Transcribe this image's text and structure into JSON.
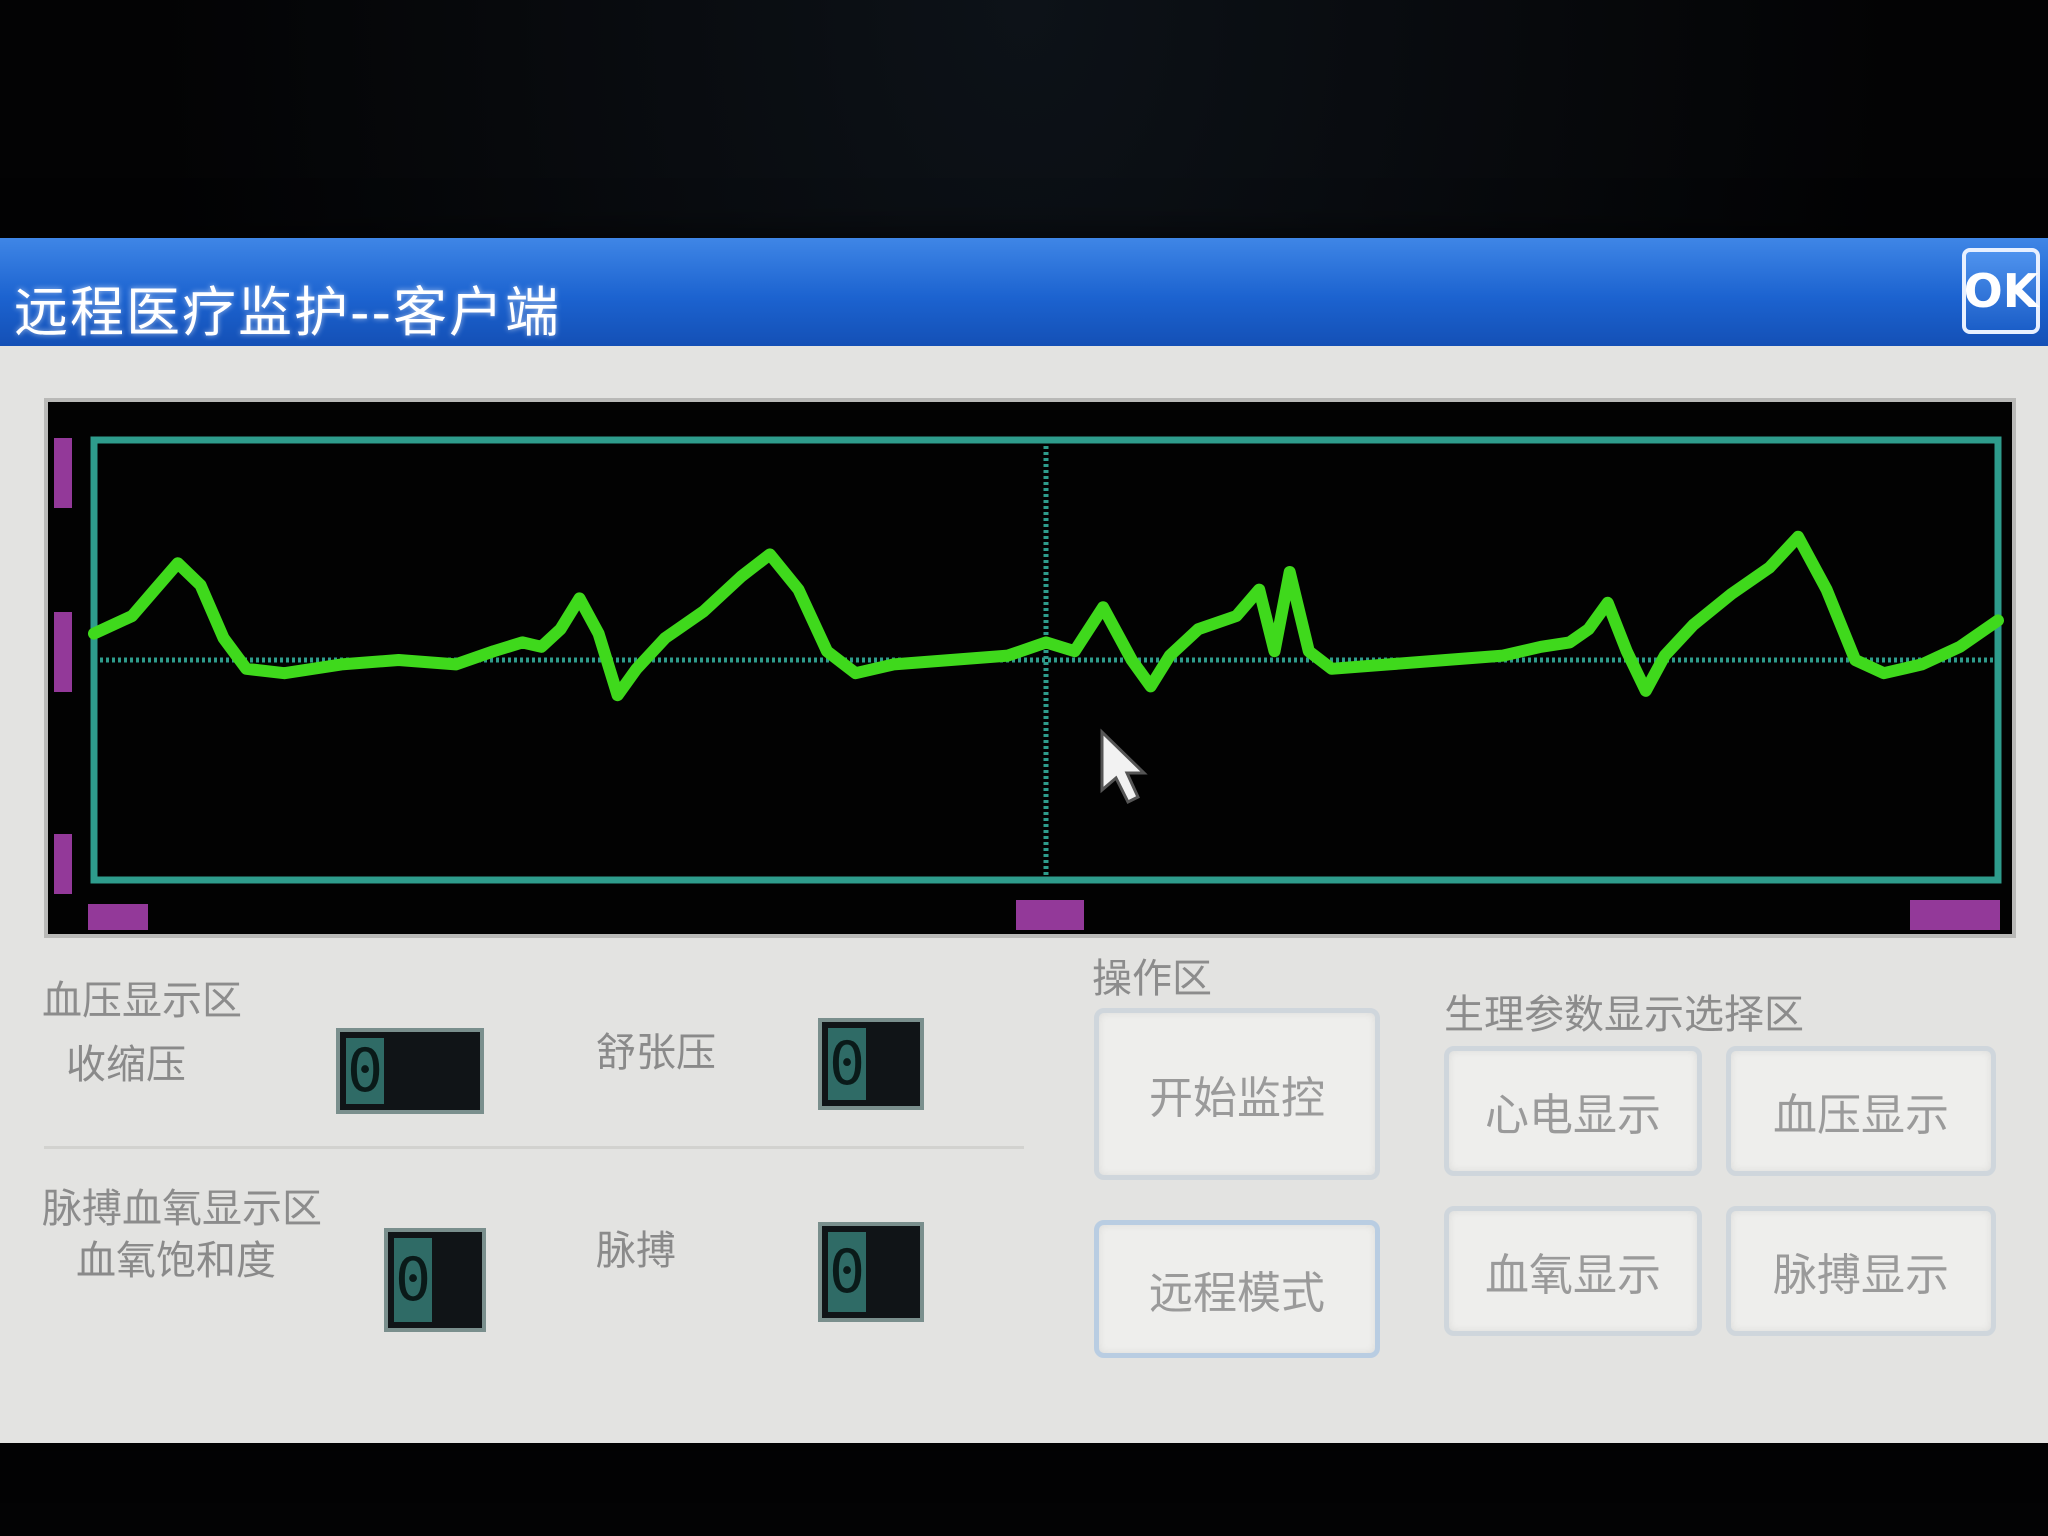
{
  "window": {
    "title": "远程医疗监护--客户端",
    "ok_label": "OK"
  },
  "bp_section": {
    "title": "血压显示区",
    "systolic_label": "收缩压",
    "diastolic_label": "舒张压",
    "systolic_value": "0",
    "diastolic_value": "0"
  },
  "spo2_section": {
    "title": "脉搏血氧显示区",
    "spo2_label": "血氧饱和度",
    "pulse_label": "脉搏",
    "spo2_value": "0",
    "pulse_value": "0"
  },
  "operation_section": {
    "title": "操作区",
    "start_button": "开始监控",
    "remote_button": "远程模式"
  },
  "param_section": {
    "title": "生理参数显示选择区",
    "ecg_button": "心电显示",
    "bp_button": "血压显示",
    "spo2_button": "血氧显示",
    "pulse_button": "脉搏显示"
  },
  "colors": {
    "waveform": "#3fd91c",
    "grid": "#2e9c8c",
    "axis_label": "#c44ccc",
    "titlebar": "#1c63d0"
  },
  "chart_data": {
    "type": "line",
    "grid": true,
    "xlim": [
      0,
      100
    ],
    "ylim": [
      0,
      100
    ],
    "series": [
      {
        "values": [
          [
            0,
            44
          ],
          [
            2,
            40
          ],
          [
            3.2,
            34
          ],
          [
            4.4,
            28
          ],
          [
            5.6,
            33
          ],
          [
            6.8,
            45
          ],
          [
            8,
            52
          ],
          [
            10,
            53
          ],
          [
            13,
            51
          ],
          [
            16,
            50
          ],
          [
            19,
            51
          ],
          [
            21,
            48
          ],
          [
            22.5,
            46
          ],
          [
            23.5,
            47
          ],
          [
            24.5,
            43
          ],
          [
            25.5,
            36
          ],
          [
            26.5,
            44
          ],
          [
            27.5,
            58
          ],
          [
            28.5,
            52
          ],
          [
            30,
            45
          ],
          [
            32,
            39
          ],
          [
            34,
            31
          ],
          [
            35.5,
            26
          ],
          [
            37,
            34
          ],
          [
            38.5,
            48
          ],
          [
            40,
            53
          ],
          [
            42,
            51
          ],
          [
            45,
            50
          ],
          [
            48,
            49
          ],
          [
            50,
            46
          ],
          [
            51.5,
            48
          ],
          [
            53,
            38
          ],
          [
            54.5,
            50
          ],
          [
            55.5,
            56
          ],
          [
            56.5,
            49
          ],
          [
            58,
            43
          ],
          [
            60,
            40
          ],
          [
            61.2,
            34
          ],
          [
            62,
            48
          ],
          [
            62.8,
            30
          ],
          [
            63.8,
            48
          ],
          [
            65,
            52
          ],
          [
            68,
            51
          ],
          [
            71,
            50
          ],
          [
            74,
            49
          ],
          [
            76,
            47
          ],
          [
            77.5,
            46
          ],
          [
            78.5,
            43
          ],
          [
            79.5,
            37
          ],
          [
            80.5,
            48
          ],
          [
            81.5,
            57
          ],
          [
            82.5,
            49
          ],
          [
            84,
            42
          ],
          [
            86,
            35
          ],
          [
            88,
            29
          ],
          [
            89.5,
            22
          ],
          [
            91,
            34
          ],
          [
            92.5,
            50
          ],
          [
            94,
            53
          ],
          [
            96,
            51
          ],
          [
            98,
            47
          ],
          [
            100,
            41
          ]
        ]
      }
    ]
  }
}
